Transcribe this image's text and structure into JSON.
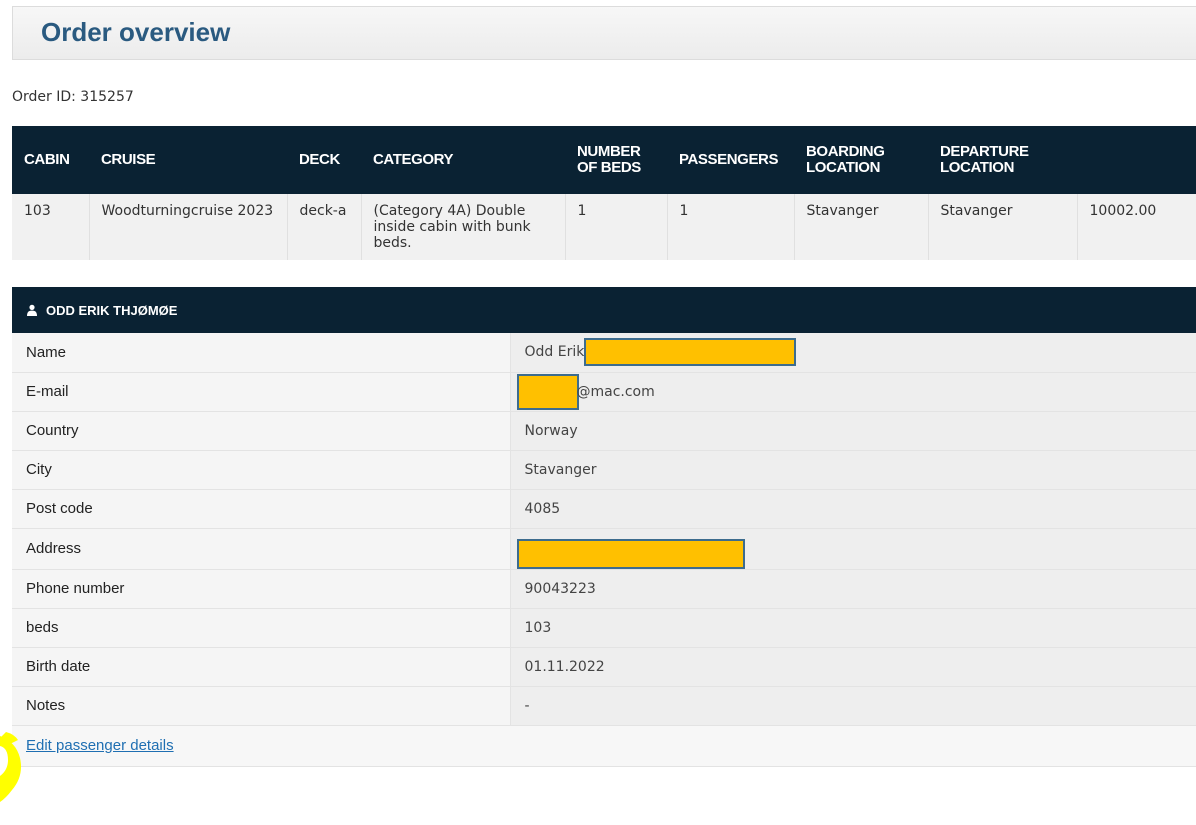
{
  "page": {
    "title": "Order overview",
    "order_id": "Order ID: 315257"
  },
  "order_table": {
    "headers": [
      "CABIN",
      "CRUISE",
      "DECK",
      "CATEGORY",
      "NUMBER OF BEDS",
      "PASSENGERS",
      "BOARDING LOCATION",
      "DEPARTURE LOCATION",
      ""
    ],
    "row": [
      "103",
      "Woodturningcruise 2023",
      "deck-a",
      "(Category 4A) Double inside cabin with bunk beds.",
      "1",
      "1",
      "Stavanger",
      "Stavanger",
      "10002.00"
    ]
  },
  "passenger": {
    "header": "ODD ERIK THJØMØE",
    "details": [
      {
        "label": "Name",
        "value": "Odd Erik"
      },
      {
        "label": "E-mail",
        "value": "@mac.com"
      },
      {
        "label": "Country",
        "value": "Norway"
      },
      {
        "label": "City",
        "value": "Stavanger"
      },
      {
        "label": "Post code",
        "value": "4085"
      },
      {
        "label": "Address",
        "value": ""
      },
      {
        "label": "Phone number",
        "value": "90043223"
      },
      {
        "label": "beds",
        "value": "103"
      },
      {
        "label": "Birth date",
        "value": "01.11.2022"
      },
      {
        "label": "Notes",
        "value": "-"
      }
    ],
    "edit_link": "Edit passenger details"
  },
  "colors": {
    "header_bg": "#0a2233",
    "title": "#2a5a80",
    "redaction": "#ffc000",
    "highlight": "#ffff00",
    "link": "#1f6fb2"
  }
}
